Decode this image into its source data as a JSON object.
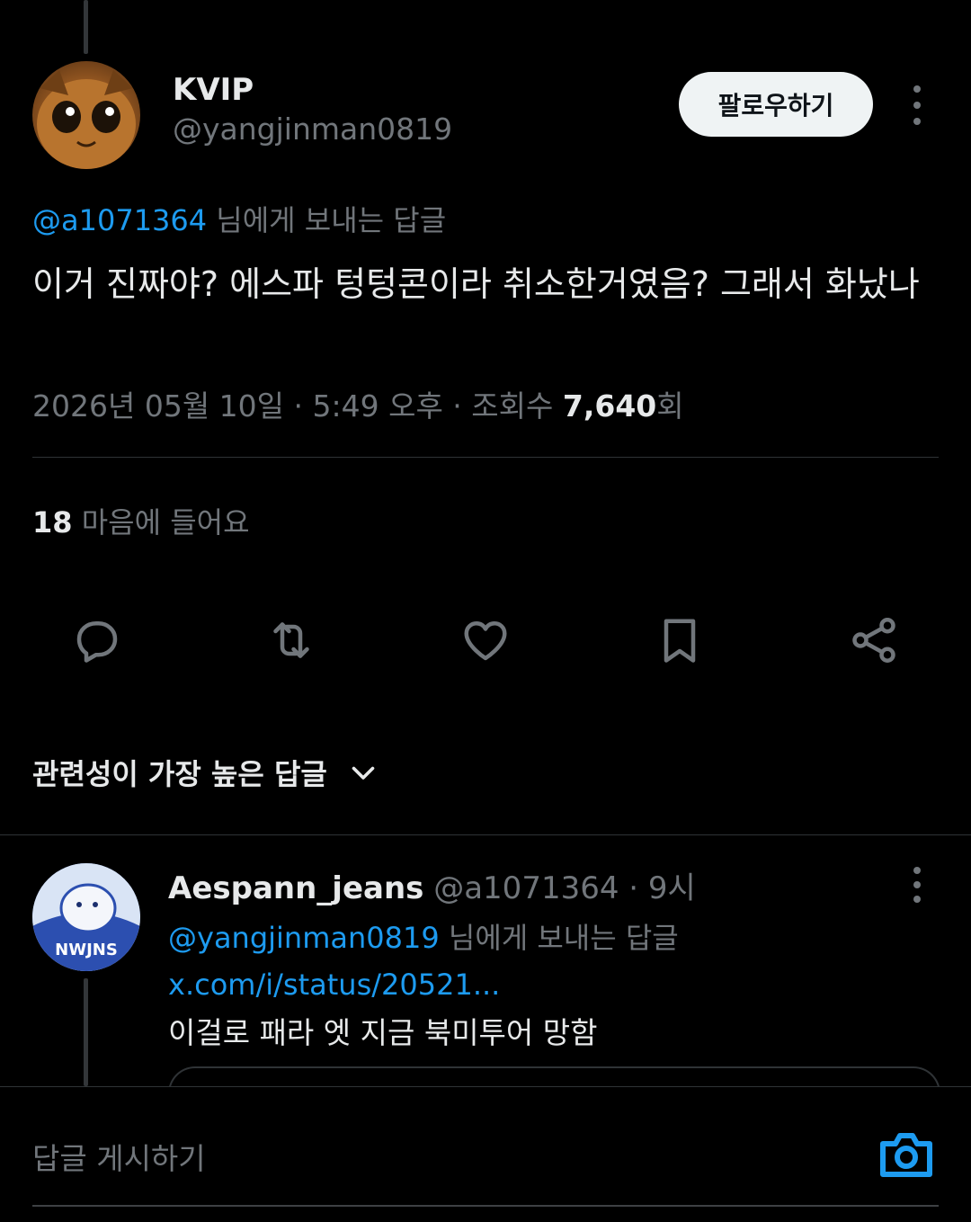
{
  "tweet": {
    "display_name": "KVIP",
    "handle": "@yangjinman0819",
    "follow_label": "팔로우하기",
    "reply_to_mention": "@a1071364",
    "reply_to_suffix": " 님에게 보내는 답글",
    "text": "이거 진짜야? 에스파 텅텅콘이라 취소한거였음? 그래서 화났나",
    "date_time": "2026년 05월 10일 · 5:49 오후 · 조회수 ",
    "views": "7,640",
    "views_suffix": "회",
    "like_count": "18",
    "like_label": " 마음에 들어요"
  },
  "actions": [
    "reply-icon",
    "retweet-icon",
    "heart-icon",
    "bookmark-icon",
    "share-icon"
  ],
  "sort_label": "관련성이 가장 높은 답글",
  "reply": {
    "display_name": "Aespann_jeans",
    "handle": " @a1071364",
    "time": " · 9시",
    "reply_to_mention": "@yangjinman0819",
    "reply_to_suffix": " 님에게 보내는 답글",
    "link": "x.com/i/status/20521...",
    "text": "이걸로 패라 엣 지금 북미투어 망함"
  },
  "composer": {
    "placeholder": "답글 게시하기"
  },
  "colors": {
    "accent": "#1d9bf0",
    "background": "#000000",
    "muted": "#71767b"
  }
}
